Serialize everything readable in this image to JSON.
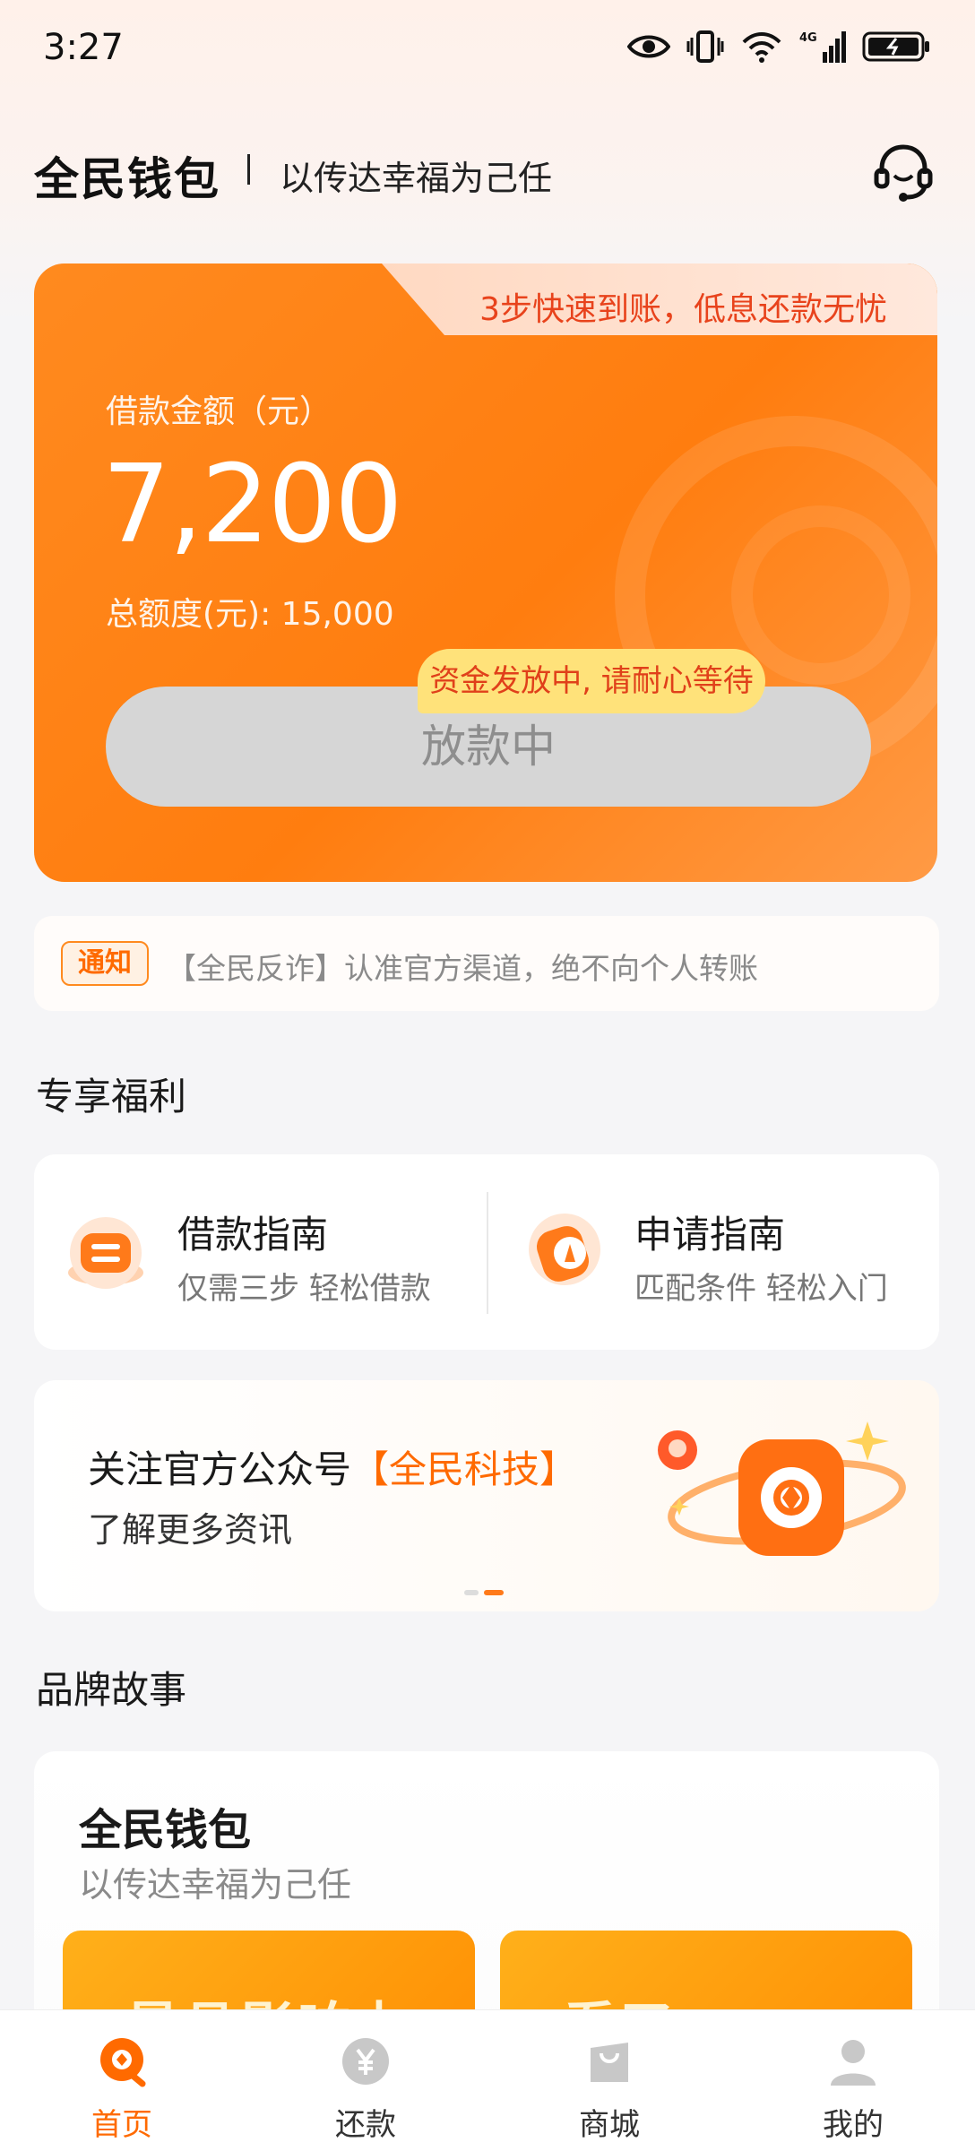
{
  "status_bar": {
    "time": "3:27",
    "icons": [
      "eye-icon",
      "vibrate-icon",
      "wifi-icon",
      "signal-4g-icon",
      "battery-icon"
    ]
  },
  "header": {
    "logo": "全民钱包",
    "slogan": "以传达幸福为己任",
    "support_icon": "headset-icon"
  },
  "loan_card": {
    "tab_text": "3步快速到账，低息还款无忧",
    "label": "借款金额（元）",
    "amount": "7,200",
    "total": "总额度(元): 15,000",
    "status_bubble": "资金发放中, 请耐心等待",
    "button_label": "放款中",
    "colors": {
      "primary": "#ff7d0f",
      "bubble": "#ffe27a",
      "bubble_text": "#e0401a"
    }
  },
  "notice": {
    "tag": "通知",
    "text": "【全民反诈】认准官方渠道，绝不向个人转账"
  },
  "benefits": {
    "title": "专享福利",
    "items": [
      {
        "title": "借款指南",
        "subtitle": "仅需三步 轻松借款",
        "icon": "loan-guide-icon"
      },
      {
        "title": "申请指南",
        "subtitle": "匹配条件 轻松入门",
        "icon": "compass-icon"
      }
    ]
  },
  "banner": {
    "title_prefix": "关注官方公众号",
    "title_highlight": "【全民科技】",
    "subtitle": "了解更多资讯",
    "page_count": 2,
    "active_page": 2
  },
  "brand_story": {
    "section_title": "品牌故事",
    "title": "全民钱包",
    "subtitle": "以传达幸福为己任",
    "tiles": [
      "最具影响力",
      "看了"
    ]
  },
  "bottom_nav": {
    "items": [
      {
        "label": "首页",
        "icon": "home-q-icon",
        "active": true
      },
      {
        "label": "还款",
        "icon": "yuan-icon",
        "active": false
      },
      {
        "label": "商城",
        "icon": "shopping-bag-icon",
        "active": false
      },
      {
        "label": "我的",
        "icon": "user-icon",
        "active": false
      }
    ]
  }
}
